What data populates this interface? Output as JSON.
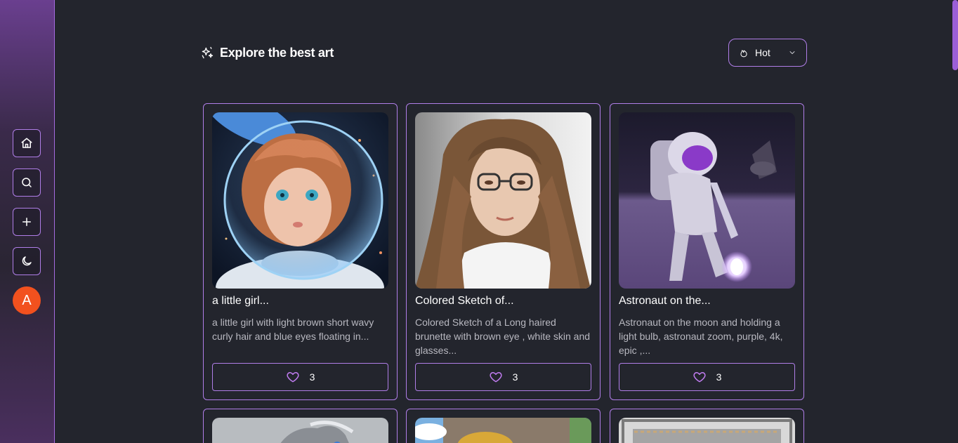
{
  "sidebar": {
    "items": [
      {
        "name": "home",
        "icon": "home-icon"
      },
      {
        "name": "search",
        "icon": "search-icon"
      },
      {
        "name": "create",
        "icon": "plus-icon"
      },
      {
        "name": "theme",
        "icon": "moon-icon"
      }
    ],
    "avatar_initial": "A",
    "avatar_color": "#f2511e"
  },
  "header": {
    "title": "Explore the best art",
    "title_icon": "sparkles-icon",
    "sort": {
      "icon": "flame-icon",
      "selected": "Hot"
    }
  },
  "colors": {
    "accent": "#b07ee8",
    "background": "#23252d",
    "heart": "#c07cf0"
  },
  "cards": [
    {
      "title": "a little girl...",
      "description": "a little girl with light brown short wavy curly hair and blue eyes floating in...",
      "likes": "3"
    },
    {
      "title": "Colored Sketch of...",
      "description": "Colored Sketch of a Long haired brunette with brown eye , white skin and glasses...",
      "likes": "3"
    },
    {
      "title": "Astronaut on the...",
      "description": "Astronaut on the moon and holding a light bulb, astronaut zoom, purple, 4k, epic ,...",
      "likes": "3"
    }
  ]
}
